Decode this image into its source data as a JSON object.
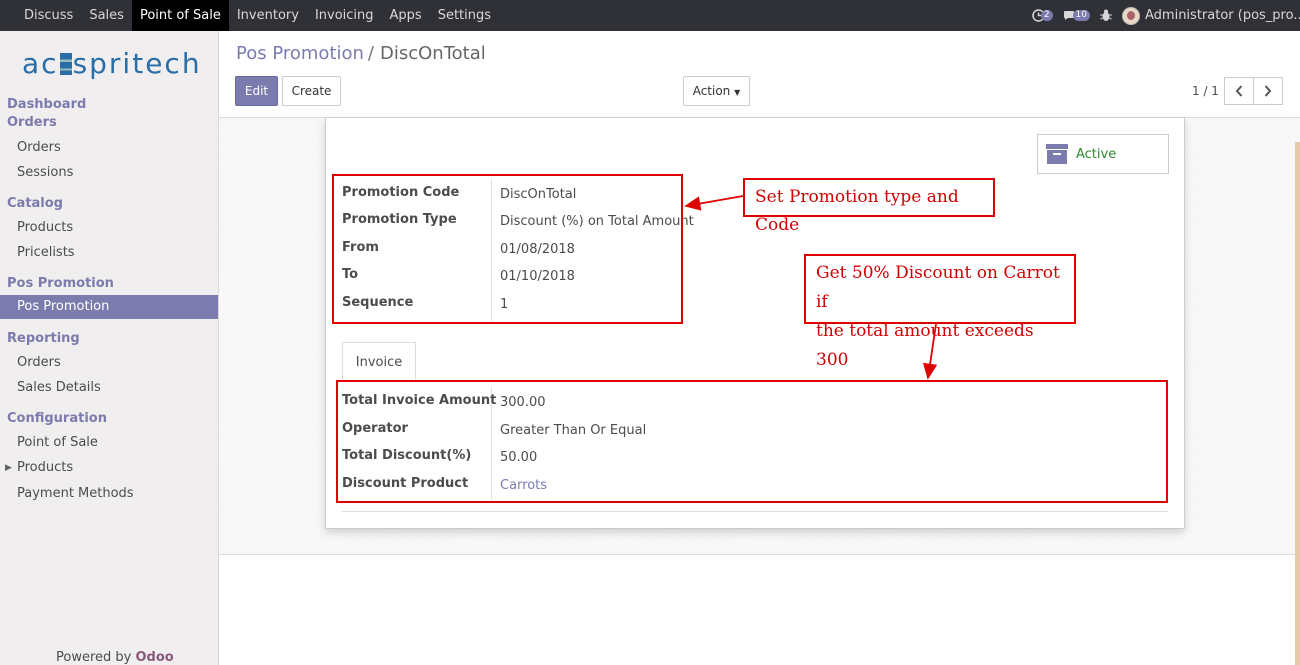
{
  "topnav": {
    "items": [
      "Discuss",
      "Sales",
      "Point of Sale",
      "Inventory",
      "Invoicing",
      "Apps",
      "Settings"
    ],
    "active_index": 2,
    "activity_count": "2",
    "message_count": "10",
    "user": "Administrator (pos_pro..."
  },
  "sidebar": {
    "logo": "acspritech",
    "sections": {
      "dashboard": "Dashboard",
      "orders": "Orders",
      "orders_items": [
        "Orders",
        "Sessions"
      ],
      "catalog": "Catalog",
      "catalog_items": [
        "Products",
        "Pricelists"
      ],
      "pos_promotion": "Pos Promotion",
      "pos_promotion_items": [
        "Pos Promotion"
      ],
      "reporting": "Reporting",
      "reporting_items": [
        "Orders",
        "Sales Details"
      ],
      "configuration": "Configuration",
      "configuration_items": [
        "Point of Sale",
        "Products",
        "Payment Methods"
      ]
    },
    "powered_by": "Powered by",
    "brand": "Odoo"
  },
  "control_panel": {
    "breadcrumb_parent": "Pos Promotion",
    "breadcrumb_sep": "/",
    "breadcrumb_current": "DiscOnTotal",
    "edit_label": "Edit",
    "create_label": "Create",
    "action_label": "Action",
    "pager": "1 / 1"
  },
  "form": {
    "active_label": "Active",
    "fields": [
      {
        "label": "Promotion Code",
        "value": "DiscOnTotal"
      },
      {
        "label": "Promotion Type",
        "value": "Discount (%) on Total Amount"
      },
      {
        "label": "From",
        "value": "01/08/2018"
      },
      {
        "label": "To",
        "value": "01/10/2018"
      },
      {
        "label": "Sequence",
        "value": "1"
      }
    ],
    "tab_label": "Invoice",
    "invoice_fields": [
      {
        "label": "Total Invoice Amount",
        "value": "300.00"
      },
      {
        "label": "Operator",
        "value": "Greater Than Or Equal"
      },
      {
        "label": "Total Discount(%)",
        "value": "50.00"
      },
      {
        "label": "Discount Product",
        "value": "Carrots"
      }
    ]
  },
  "annotations": {
    "callout_1": "Set Promotion type and Code",
    "callout_2_line1": "Get 50% Discount on Carrot if",
    "callout_2_line2": "the total amount exceeds 300"
  },
  "colors": {
    "accent": "#7c7bad",
    "annotation": "#e00000",
    "active_green": "#2d8a2d"
  }
}
